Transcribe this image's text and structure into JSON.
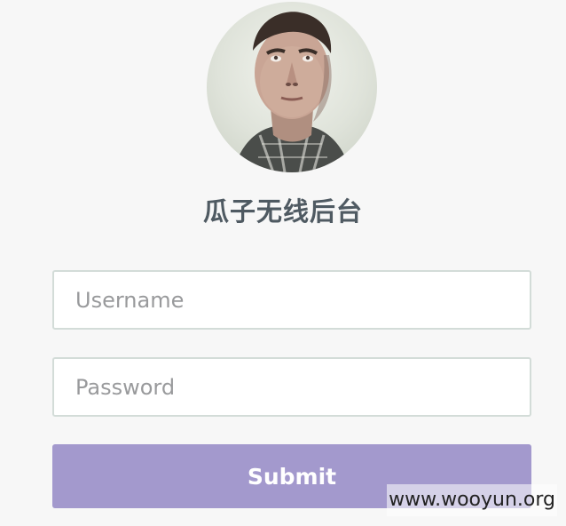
{
  "app": {
    "title": "瓜子无线后台"
  },
  "login_form": {
    "username_placeholder": "Username",
    "username_value": "",
    "password_placeholder": "Password",
    "password_value": "",
    "submit_label": "Submit"
  },
  "watermark": {
    "text": "www.wooyun.org"
  },
  "colors": {
    "background": "#f7f7f7",
    "title_text": "#4f5a62",
    "input_border": "#d3dcd8",
    "submit_button": "#a399cd"
  },
  "icons": {
    "avatar": "user-avatar-photo"
  }
}
